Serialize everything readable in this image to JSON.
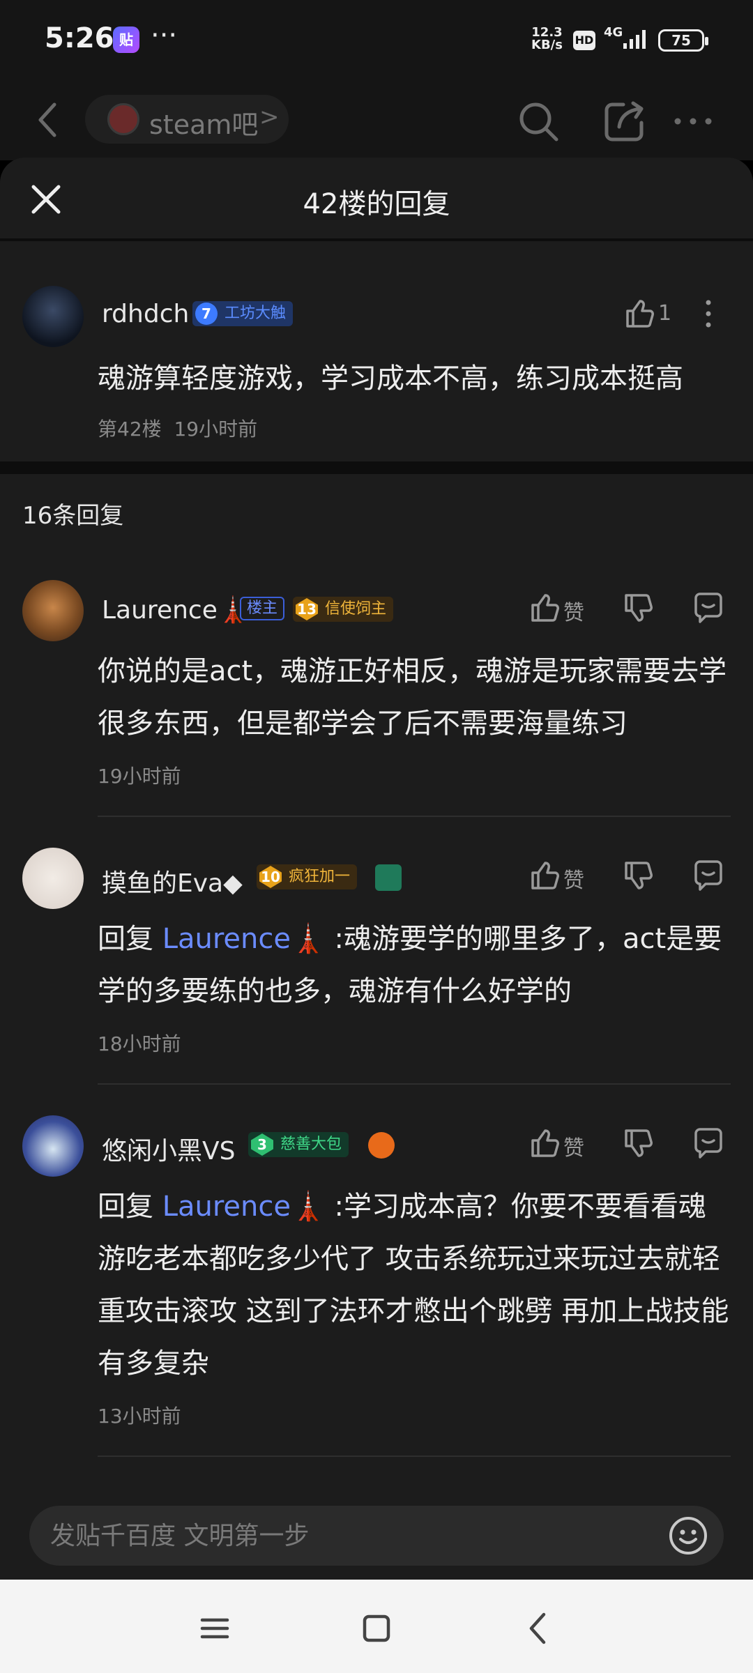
{
  "status_bar": {
    "time": "5:26",
    "app_icon_text": "贴",
    "more": "···",
    "speed_top": "12.3",
    "speed_bottom": "KB/s",
    "hd": "HD",
    "network": "4G",
    "battery": "75"
  },
  "app_bar": {
    "forum_name": "steam吧",
    "chevron": ">"
  },
  "sheet": {
    "title": "42楼的回复"
  },
  "main_post": {
    "username": "rdhdch",
    "level": "7",
    "badge": "工坊大触",
    "likes": "1",
    "content": "魂游算轻度游戏，学习成本不高，练习成本挺高",
    "floor": "第42楼",
    "time": "19小时前"
  },
  "reply_count": "16条回复",
  "replies": [
    {
      "username": "Laurence🗼",
      "owner_tag": "楼主",
      "level": "13",
      "badge": "信使饲主",
      "like_label": "赞",
      "content": "你说的是act，魂游正好相反，魂游是玩家需要去学很多东西，但是都学会了后不需要海量练习",
      "time": "19小时前"
    },
    {
      "username": "摸鱼的Eva◆",
      "level": "10",
      "badge": "疯狂加一",
      "like_label": "赞",
      "reply_prefix": "回复 ",
      "mention": "Laurence🗼",
      "content": " :魂游要学的哪里多了，act是要学的多要练的也多，魂游有什么好学的",
      "time": "18小时前"
    },
    {
      "username": "悠闲小黑VS",
      "level": "3",
      "badge": "慈善大包",
      "like_label": "赞",
      "reply_prefix": "回复 ",
      "mention": "Laurence🗼",
      "content": " :学习成本高？你要不要看看魂游吃老本都吃多少代了 攻击系统玩过来玩过去就轻重攻击滚攻 这到了法环才憋出个跳劈 再加上战技能有多复杂",
      "time": "13小时前"
    }
  ],
  "input": {
    "placeholder": "发贴千百度 文明第一步"
  },
  "colors": {
    "sheet_bg": "#1c1c1c",
    "mention": "#6b8cff",
    "badge_blue": "#2b5fd9",
    "badge_orange": "#e8a21a",
    "badge_green": "#2fbf71"
  }
}
